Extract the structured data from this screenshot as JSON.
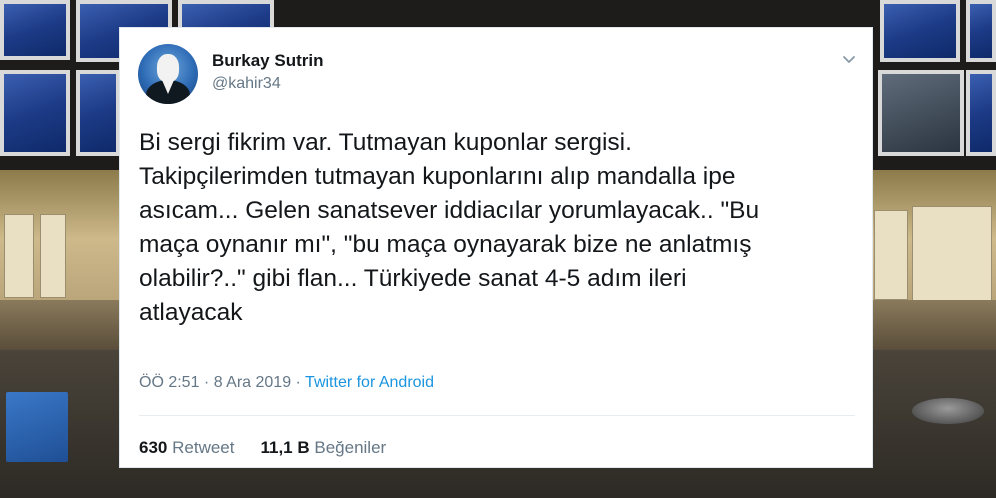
{
  "tweet": {
    "author_name": "Burkay Sutrin",
    "author_handle": "@kahir34",
    "text": "Bi sergi fikrim var. Tutmayan kuponlar sergisi.\nTakipçilerimden tutmayan kuponlarını alıp mandalla ipe\nasıcam... Gelen sanatsever iddiacılar yorumlayacak.. \"Bu\nmaça oynanır mı\", \"bu maça oynayarak bize ne anlatmış\nolabilir?..\" gibi flan... Türkiyede sanat 4-5 adım ileri\natlayacak",
    "time": "ÖÖ 2:51",
    "separator": " · ",
    "date": "8 Ara 2019",
    "source": "Twitter for Android",
    "retweet_count": "630",
    "retweet_label": "Retweet",
    "like_count": "11,1 B",
    "like_label": "Beğeniler"
  },
  "icons": {
    "avatar": "profile-avatar",
    "menu": "chevron-down-icon"
  },
  "colors": {
    "link": "#1b95e0",
    "secondary_text": "#657786",
    "primary_text": "#14171a"
  }
}
